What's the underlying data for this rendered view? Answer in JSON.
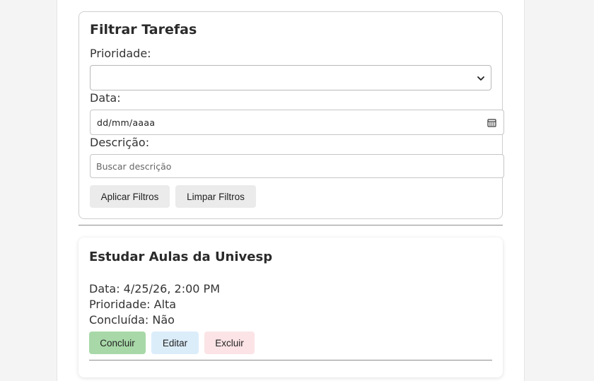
{
  "filter": {
    "title": "Filtrar Tarefas",
    "priority_label": "Prioridade:",
    "priority_value": "",
    "date_label": "Data:",
    "date_placeholder": "dd/mm/aaaa",
    "description_label": "Descrição:",
    "description_placeholder": "Buscar descrição",
    "description_value": "",
    "apply_label": "Aplicar Filtros",
    "clear_label": "Limpar Filtros"
  },
  "task": {
    "title": "Estudar Aulas da Univesp",
    "date_line": "Data: 4/25/26, 2:00 PM",
    "priority_line": "Prioridade: Alta",
    "completed_line": "Concluída: Não",
    "complete_label": "Concluir",
    "edit_label": "Editar",
    "delete_label": "Excluir"
  },
  "icons": {
    "select_arrow": "chevron-down-icon",
    "date_picker": "calendar-icon"
  },
  "colors": {
    "complete_button": "#a8d8a8",
    "edit_button": "#dcedfa",
    "delete_button": "#fbe3e6",
    "neutral_button": "#ebebeb"
  }
}
